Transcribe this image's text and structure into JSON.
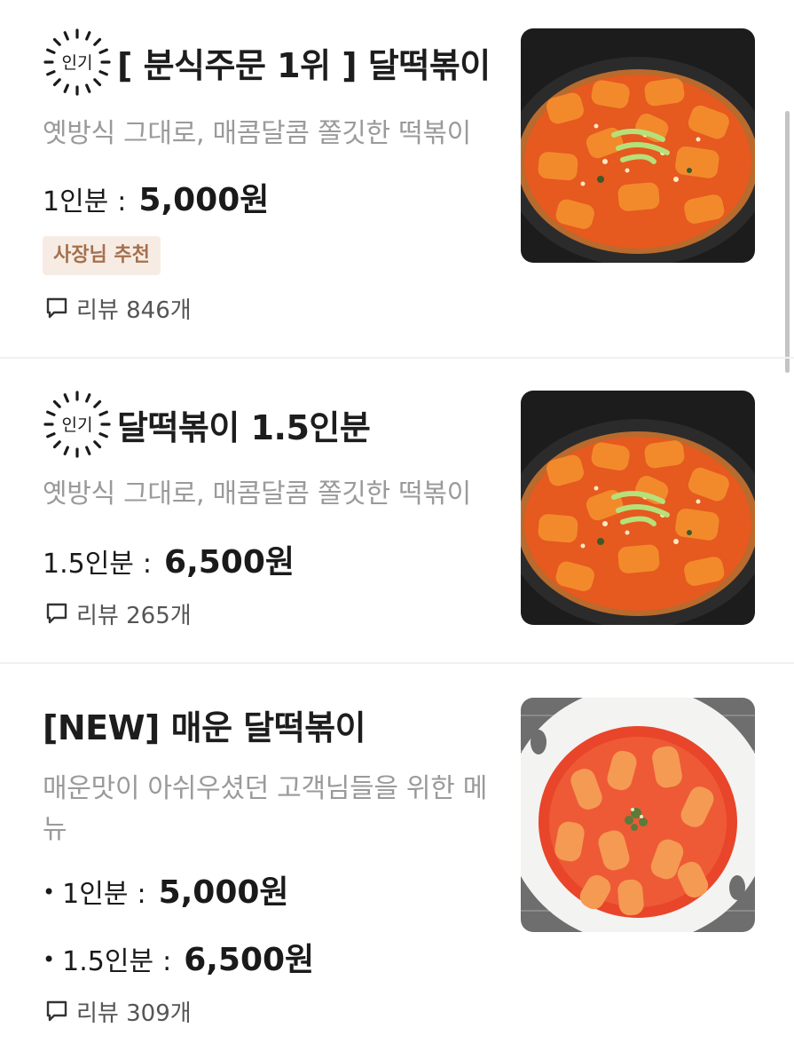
{
  "colors": {
    "accent_bg": "#f7ece4",
    "accent_text": "#a4714d",
    "muted_text": "#9a9a9a",
    "divider": "#f1f1f1"
  },
  "badge": {
    "popular_label": "인기",
    "icon": "popular-sunburst-icon"
  },
  "items": [
    {
      "title": "[ 분식주문 1위 ] 달떡볶이",
      "description": "옛방식 그대로, 매콤달콤 쫄깃한 떡볶이",
      "prices": [
        {
          "label": "1인분",
          "sep": ":",
          "value": "5,000원"
        }
      ],
      "tag": "사장님 추천",
      "review": "리뷰 846개",
      "image": "tteokbokki-black-bowl"
    },
    {
      "title": "달떡볶이 1.5인분",
      "description": "옛방식 그대로, 매콤달콤 쫄깃한 떡볶이",
      "prices": [
        {
          "label": "1.5인분",
          "sep": ":",
          "value": "6,500원"
        }
      ],
      "review": "리뷰 265개",
      "image": "tteokbokki-black-bowl"
    },
    {
      "title": "[NEW] 매운 달떡볶이",
      "description_line1": "매운맛이 아쉬우셨던 고객님들을 위한 메",
      "description_line2": "뉴",
      "prices": [
        {
          "bullet": "•",
          "label": "1인분",
          "sep": ":",
          "value": "5,000원"
        },
        {
          "bullet": "•",
          "label": "1.5인분",
          "sep": ":",
          "value": "6,500원"
        }
      ],
      "review": "리뷰 309개",
      "image": "spicy-tteokbokki-white-bowl"
    }
  ]
}
